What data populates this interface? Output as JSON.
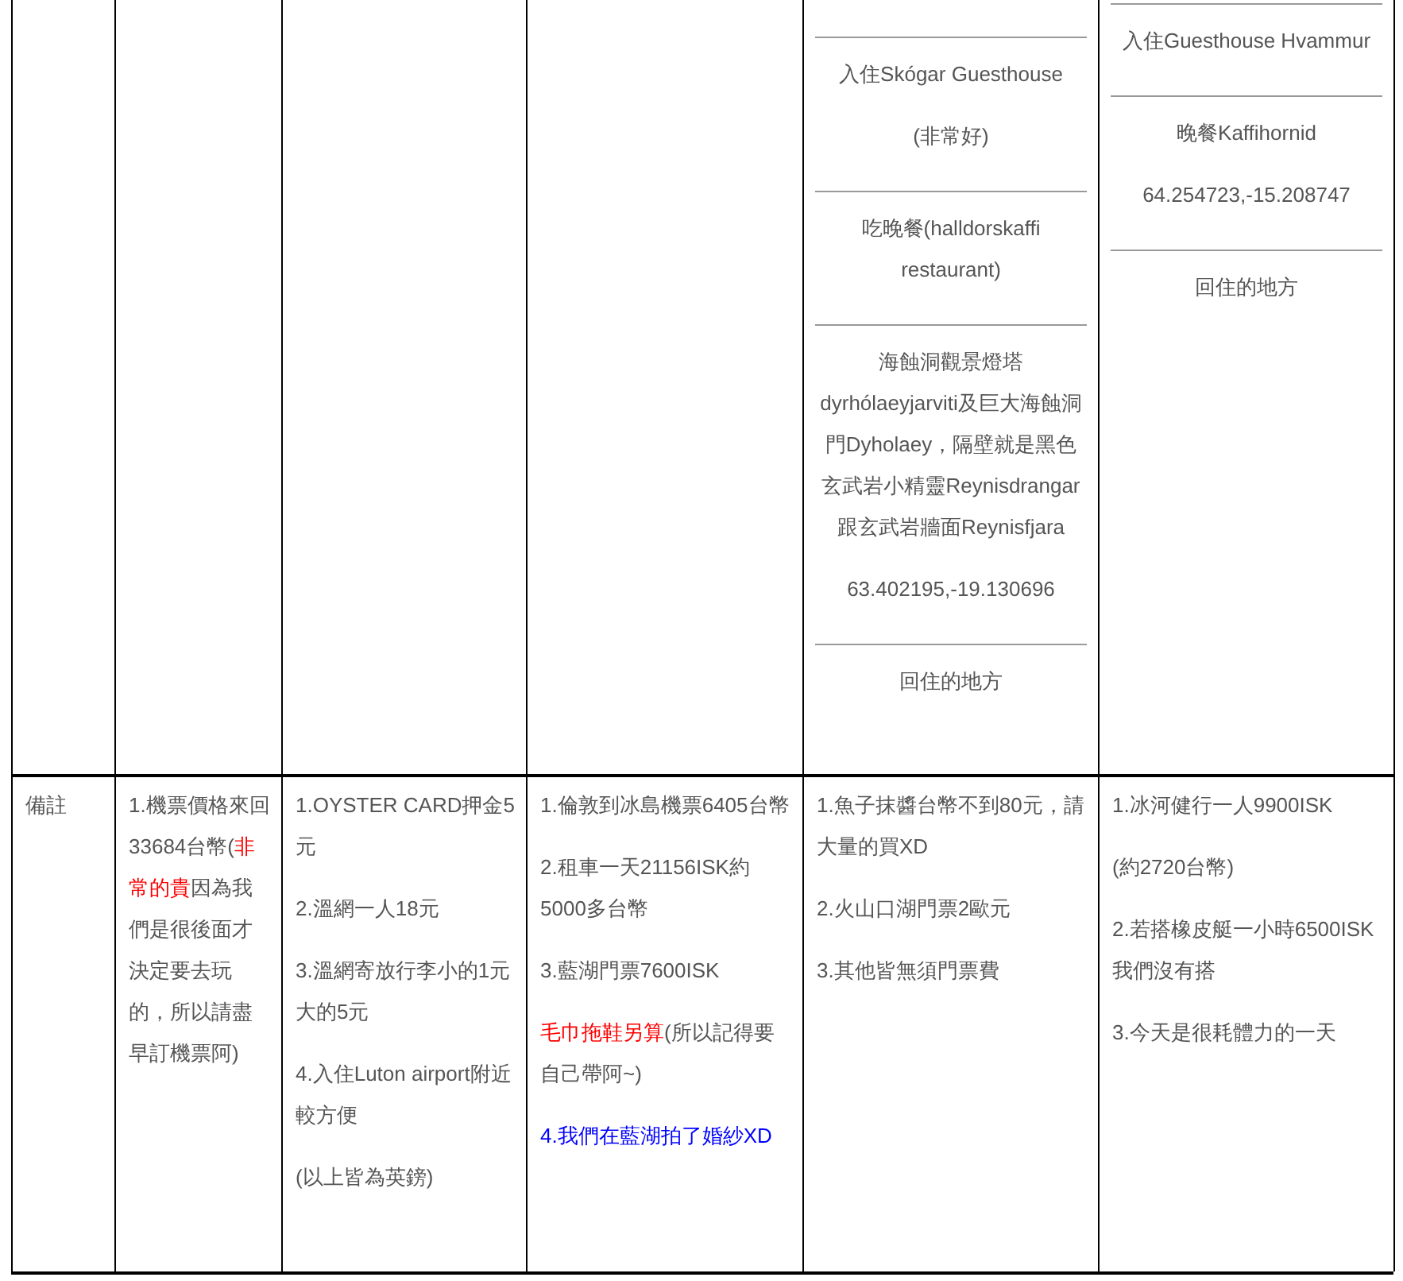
{
  "top_row": {
    "cells": [
      {},
      {},
      {},
      {},
      {
        "sections": [
          {
            "paragraphs": [
              "入住Skógar Guesthouse",
              "(非常好)"
            ]
          },
          {
            "paragraphs": [
              "吃晚餐(halldorskaffi restaurant)"
            ]
          },
          {
            "paragraphs": [
              "海蝕洞觀景燈塔dyrhólaeyjarviti及巨大海蝕洞門Dyholaey，隔壁就是黑色玄武岩小精靈Reynisdrangar跟玄武岩牆面Reynisfjara",
              "63.402195,-19.130696"
            ]
          },
          {
            "paragraphs": [
              "回住的地方"
            ]
          }
        ]
      },
      {
        "sections": [
          {
            "paragraphs": [
              "入住Guesthouse Hvammur"
            ]
          },
          {
            "paragraphs": [
              "晚餐Kaffihornid",
              "64.254723,-15.208747"
            ]
          },
          {
            "paragraphs": [
              "回住的地方"
            ]
          }
        ]
      }
    ]
  },
  "notes_row": {
    "label": "備註",
    "cells": [
      {
        "paragraphs": [
          [
            {
              "text": "1.機票價格來回33684台幣("
            },
            {
              "text": "非常的貴",
              "color": "#ff0000"
            },
            {
              "text": "因為我們是很後面才決定要去玩的，所以請盡早訂機票阿)"
            }
          ]
        ]
      },
      {
        "paragraphs": [
          [
            {
              "text": "1.OYSTER CARD押金5元"
            }
          ],
          [
            {
              "text": "2.溫網一人18元"
            }
          ],
          [
            {
              "text": "3.溫網寄放行李小的1元大的5元"
            }
          ],
          [
            {
              "text": "4.入住Luton airport附近較方便"
            }
          ],
          [
            {
              "text": "(以上皆為英鎊)"
            }
          ]
        ]
      },
      {
        "paragraphs": [
          [
            {
              "text": "1.倫敦到冰島機票6405台幣"
            }
          ],
          [
            {
              "text": "2.租車一天21156ISK約5000多台幣"
            }
          ],
          [
            {
              "text": "3.藍湖門票7600ISK"
            }
          ],
          [
            {
              "text": "毛巾拖鞋另算",
              "color": "#ff0000"
            },
            {
              "text": "(所以記得要自己帶阿~)"
            }
          ],
          [
            {
              "text": "4.我們在藍湖拍了婚紗XD",
              "color": "#0000ff"
            }
          ]
        ]
      },
      {
        "paragraphs": [
          [
            {
              "text": "1.魚子抹醬台幣不到80元，請大量的買XD"
            }
          ],
          [
            {
              "text": "2.火山口湖門票2歐元"
            }
          ],
          [
            {
              "text": "3.其他皆無須門票費"
            }
          ]
        ]
      },
      {
        "paragraphs": [
          [
            {
              "text": "1.冰河健行一人9900ISK"
            }
          ],
          [
            {
              "text": "(約2720台幣)"
            }
          ],
          [
            {
              "text": "2.若搭橡皮艇一小時6500ISK我們沒有搭"
            }
          ],
          [
            {
              "text": "3.今天是很耗體力的一天"
            }
          ]
        ]
      }
    ]
  }
}
